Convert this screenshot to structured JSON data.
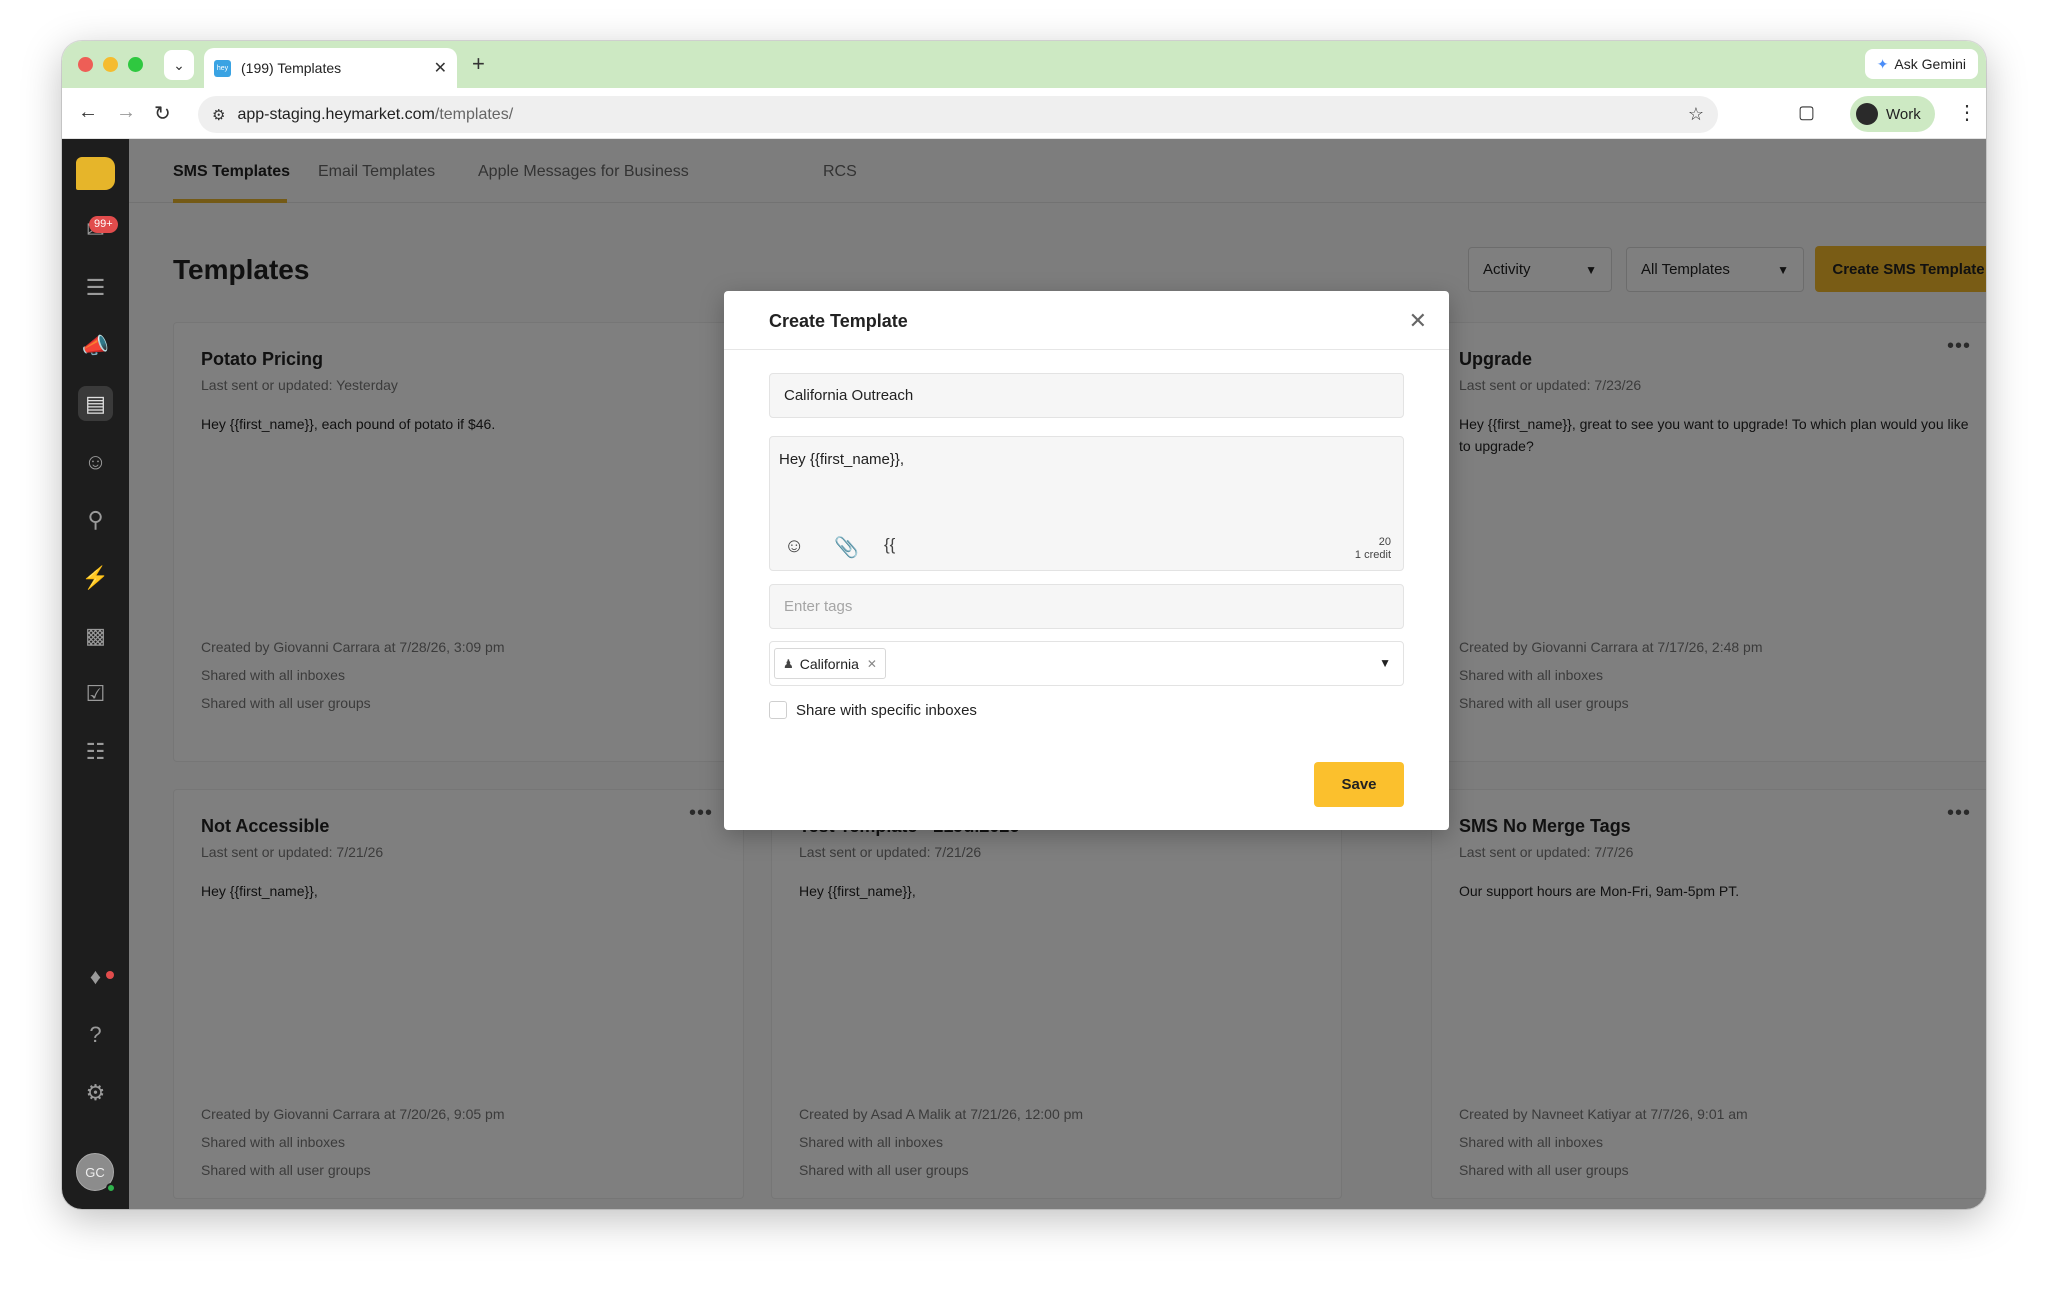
{
  "browser": {
    "tab_title": "(199) Templates",
    "tab_favicon": "hey",
    "ask_gemini": "Ask Gemini",
    "url_host": "app-staging.heymarket.com",
    "url_path": "/templates/",
    "profile": "Work"
  },
  "sidebar": {
    "badge": "99+",
    "avatar": "GC"
  },
  "tabs": [
    "SMS Templates",
    "Email Templates",
    "Apple Messages for Business",
    "RCS"
  ],
  "page": {
    "title": "Templates",
    "filter_activity": "Activity",
    "filter_templates": "All Templates",
    "create_button": "Create SMS Template"
  },
  "cards": [
    {
      "title": "Potato Pricing",
      "meta": "Last sent or updated: Yesterday",
      "body": "Hey {{first_name}}, each pound of potato if $46.",
      "created": "Created by Giovanni Carrara at 7/28/26, 3:09 pm",
      "shared_inboxes": "Shared with all inboxes",
      "shared_groups": "Shared with all user groups"
    },
    {
      "title": "Upgrade",
      "meta": "Last sent or updated: 7/23/26",
      "body": "Hey {{first_name}}, great to see you want to upgrade! To which plan would you like to upgrade?",
      "created": "Created by Giovanni Carrara at 7/17/26, 2:48 pm",
      "shared_inboxes": "Shared with all inboxes",
      "shared_groups": "Shared with all user groups"
    },
    {
      "title": "Not Accessible",
      "meta": "Last sent or updated: 7/21/26",
      "body": "Hey {{first_name}},",
      "created": "Created by Giovanni Carrara at 7/20/26, 9:05 pm",
      "shared_inboxes": "Shared with all inboxes",
      "shared_groups": "Shared with all user groups"
    },
    {
      "title": "Test Template - 21Jul2026",
      "meta": "Last sent or updated: 7/21/26",
      "body": "Hey {{first_name}},",
      "created": "Created by Asad A Malik at 7/21/26, 12:00 pm",
      "shared_inboxes": "Shared with all inboxes",
      "shared_groups": "Shared with all user groups"
    },
    {
      "title": "SMS No Merge Tags",
      "meta": "Last sent or updated: 7/7/26",
      "body": "Our support hours are Mon-Fri, 9am-5pm PT.",
      "created": "Created by Navneet Katiyar at 7/7/26, 9:01 am",
      "shared_inboxes": "Shared with all inboxes",
      "shared_groups": "Shared with all user groups"
    }
  ],
  "modal": {
    "title": "Create Template",
    "name_value": "California Outreach",
    "message_value": "Hey {{first_name}},",
    "merge_icon": "{{",
    "char_count": "20",
    "credits": "1 credit",
    "tags_placeholder": "Enter tags",
    "group_chip": "California",
    "share_label": "Share with specific inboxes",
    "save_label": "Save"
  },
  "icons": {
    "sidebar": [
      "inbox-icon",
      "list-icon",
      "megaphone-icon",
      "templates-icon",
      "contacts-icon",
      "search-contacts-icon",
      "lightning-icon",
      "chart-icon",
      "clipboard-icon",
      "list-alt-icon",
      "bell-icon",
      "help-icon",
      "gear-icon"
    ]
  },
  "colors": {
    "accent": "#F2B82A",
    "save": "#FBC02D",
    "sidebar_bg": "#1D1D1D",
    "chrome_green": "#CDE9C3"
  }
}
